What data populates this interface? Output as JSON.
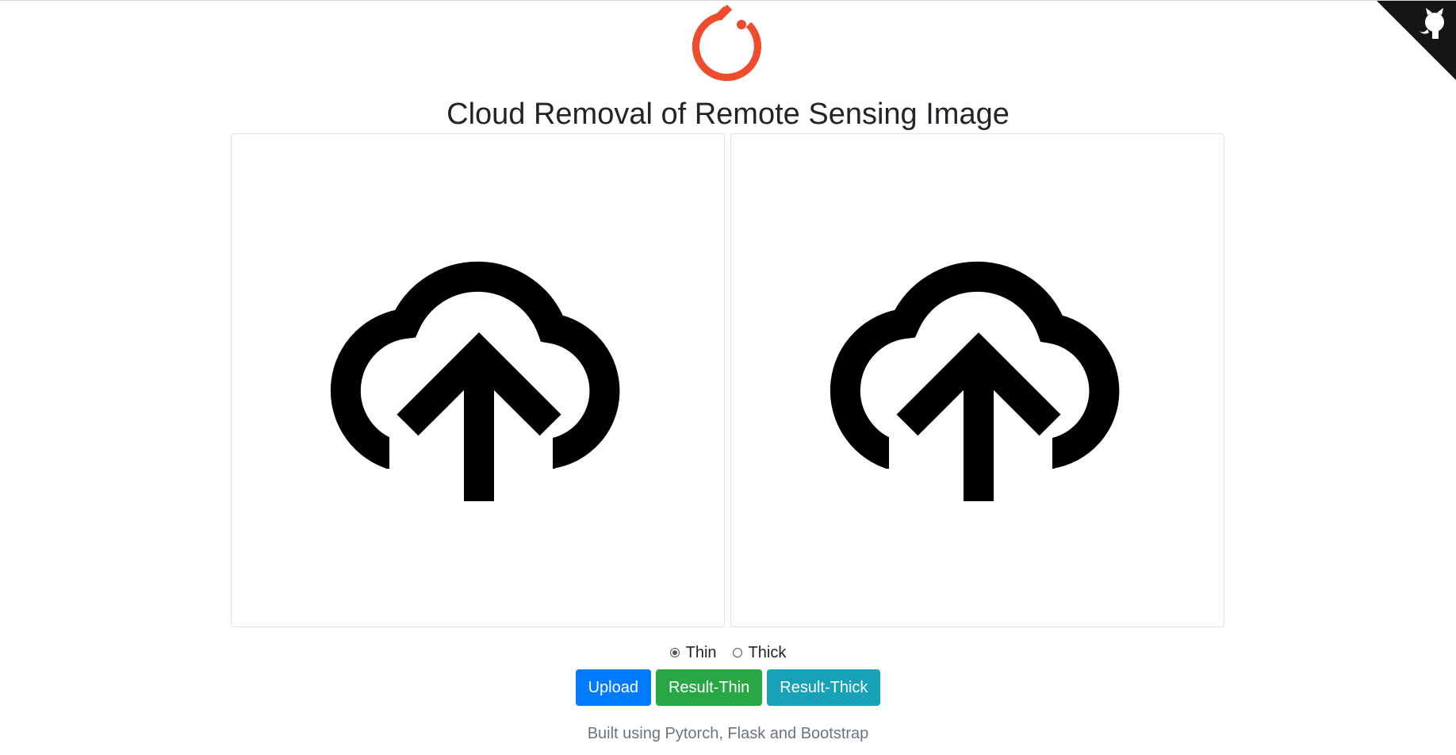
{
  "header": {
    "logo_icon": "pytorch-flame-icon",
    "logo_color": "#EE4C2C",
    "title": "Cloud Removal of Remote Sensing Image"
  },
  "panels": [
    {
      "icon": "cloud-upload-icon"
    },
    {
      "icon": "cloud-upload-icon"
    }
  ],
  "options": {
    "selected": "Thin",
    "items": [
      {
        "label": "Thin",
        "checked": true
      },
      {
        "label": "Thick",
        "checked": false
      }
    ]
  },
  "buttons": {
    "upload": "Upload",
    "result_thin": "Result-Thin",
    "result_thick": "Result-Thick",
    "colors": {
      "upload": "#007bff",
      "result_thin": "#28a745",
      "result_thick": "#17a2b8"
    }
  },
  "footer": {
    "text": "Built using Pytorch, Flask and Bootstrap"
  },
  "corner": {
    "icon": "github-octocat-icon",
    "color": "#151513"
  }
}
